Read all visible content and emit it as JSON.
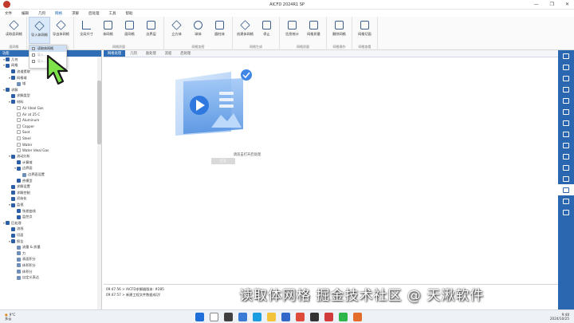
{
  "window": {
    "title": "AICFD 2024R1 SP",
    "controls": [
      "—",
      "❐",
      "✕"
    ]
  },
  "menu": [
    "文件",
    "编辑",
    "几何",
    "网格",
    "求解",
    "后处理",
    "工具",
    "帮助"
  ],
  "menu_active_index": 3,
  "ribbon": {
    "groups": [
      {
        "label": "面网格",
        "buttons": [
          {
            "label": "读取面网格",
            "icon": "mesh-read-icon"
          }
        ]
      },
      {
        "label": "",
        "buttons": [
          {
            "label": "导入体网格",
            "icon": "mesh-import-icon"
          },
          {
            "label": "导出体网格",
            "icon": "mesh-export-icon"
          }
        ]
      },
      {
        "label": "网格质量",
        "buttons": [
          {
            "label": "全局尺寸",
            "icon": "size-chart-icon"
          },
          {
            "label": "体网格",
            "icon": "volume-mesh-icon"
          },
          {
            "label": "面网格",
            "icon": "surface-mesh-icon"
          },
          {
            "label": "边界层",
            "icon": "boundary-layer-icon"
          }
        ]
      },
      {
        "label": "网格加密",
        "buttons": [
          {
            "label": "立方体",
            "icon": "cube-icon"
          },
          {
            "label": "球体",
            "icon": "sphere-icon"
          },
          {
            "label": "圆柱体",
            "icon": "cylinder-icon"
          }
        ]
      },
      {
        "label": "网格生成",
        "buttons": [
          {
            "label": "创建体网格",
            "icon": "create-mesh-icon"
          },
          {
            "label": "停止",
            "icon": "stop-icon"
          }
        ]
      },
      {
        "label": "网格质量",
        "buttons": [
          {
            "label": "信息统计",
            "icon": "statistics-icon"
          },
          {
            "label": "网格质量",
            "icon": "quality-icon"
          }
        ]
      },
      {
        "label": "网格操作",
        "buttons": [
          {
            "label": "删除网格",
            "icon": "delete-mesh-icon"
          }
        ]
      },
      {
        "label": "网格查看",
        "buttons": [
          {
            "label": "网格切面",
            "icon": "slice-icon"
          }
        ]
      }
    ]
  },
  "dropdown": {
    "items": [
      "读取体网格",
      "导入...",
      "导入..."
    ]
  },
  "left_panel": {
    "title": "功能",
    "tree": [
      {
        "label": "几何",
        "level": 0,
        "toggle": "▾",
        "icon": "node"
      },
      {
        "label": "网格",
        "level": 0,
        "toggle": "▾",
        "icon": "node"
      },
      {
        "label": "流道提取",
        "level": 1,
        "toggle": "",
        "icon": "node"
      },
      {
        "label": "网格域",
        "level": 1,
        "toggle": "▾",
        "icon": "node"
      },
      {
        "label": "域",
        "level": 2,
        "toggle": "",
        "icon": "leaf"
      },
      {
        "label": "求解",
        "level": 0,
        "toggle": "▾",
        "icon": "node"
      },
      {
        "label": "求解类型",
        "level": 1,
        "toggle": "",
        "icon": "node"
      },
      {
        "label": "材料",
        "level": 1,
        "toggle": "▾",
        "icon": "node"
      },
      {
        "label": "Air Ideal Gas",
        "level": 2,
        "toggle": "",
        "icon": "mat"
      },
      {
        "label": "Air at 25 C",
        "level": 2,
        "toggle": "",
        "icon": "mat"
      },
      {
        "label": "Aluminum",
        "level": 2,
        "toggle": "",
        "icon": "mat"
      },
      {
        "label": "Copper",
        "level": 2,
        "toggle": "",
        "icon": "mat"
      },
      {
        "label": "Soot",
        "level": 2,
        "toggle": "",
        "icon": "mat"
      },
      {
        "label": "Steel",
        "level": 2,
        "toggle": "",
        "icon": "mat"
      },
      {
        "label": "Water",
        "level": 2,
        "toggle": "",
        "icon": "mat"
      },
      {
        "label": "Water Ideal Gas",
        "level": 2,
        "toggle": "",
        "icon": "mat"
      },
      {
        "label": "流动分析",
        "level": 1,
        "toggle": "▾",
        "icon": "node"
      },
      {
        "label": "计算域",
        "level": 2,
        "toggle": "",
        "icon": "node"
      },
      {
        "label": "边界面",
        "level": 2,
        "toggle": "▾",
        "icon": "node"
      },
      {
        "label": "边界面设置",
        "level": 3,
        "toggle": "",
        "icon": "leaf"
      },
      {
        "label": "热模型",
        "level": 2,
        "toggle": "",
        "icon": "node"
      },
      {
        "label": "求解设置",
        "level": 1,
        "toggle": "",
        "icon": "node"
      },
      {
        "label": "求解控制",
        "level": 1,
        "toggle": "",
        "icon": "node"
      },
      {
        "label": "初始化",
        "level": 1,
        "toggle": "",
        "icon": "node"
      },
      {
        "label": "监视",
        "level": 1,
        "toggle": "▾",
        "icon": "node"
      },
      {
        "label": "残差曲线",
        "level": 2,
        "toggle": "",
        "icon": "node"
      },
      {
        "label": "监控点",
        "level": 2,
        "toggle": "",
        "icon": "node"
      },
      {
        "label": "后处理",
        "level": 0,
        "toggle": "▾",
        "icon": "node"
      },
      {
        "label": "流线",
        "level": 1,
        "toggle": "",
        "icon": "node"
      },
      {
        "label": "切面",
        "level": 1,
        "toggle": "",
        "icon": "node"
      },
      {
        "label": "报告",
        "level": 1,
        "toggle": "▾",
        "icon": "node"
      },
      {
        "label": "流量 & 质量",
        "level": 2,
        "toggle": "",
        "icon": "leaf"
      },
      {
        "label": "力",
        "level": 2,
        "toggle": "",
        "icon": "leaf"
      },
      {
        "label": "表面积分",
        "level": 2,
        "toggle": "",
        "icon": "leaf"
      },
      {
        "label": "体积积分",
        "level": 2,
        "toggle": "",
        "icon": "leaf"
      },
      {
        "label": "体积分",
        "level": 2,
        "toggle": "",
        "icon": "leaf"
      },
      {
        "label": "自定义表达",
        "level": 2,
        "toggle": "",
        "icon": "leaf"
      }
    ]
  },
  "tabs": [
    "网格处理",
    "几何",
    "面处理",
    "流程",
    "后处理"
  ],
  "active_tab_index": 0,
  "canvas": {
    "hint": "请双击打开后处理",
    "button": "打开"
  },
  "console": {
    "lines": [
      "09:47:56 > AICFD求解器版本: #285",
      "09:47:57 > 新建工程文件数据成功!"
    ]
  },
  "right_toolbar_selected": 12,
  "taskbar": {
    "weather_temp": "9°C",
    "weather_desc": "多云",
    "time": "9:48",
    "date": "2024/10/25",
    "apps": [
      {
        "name": "windows-start-icon",
        "color": "#1e6fd9"
      },
      {
        "name": "search-icon",
        "color": "#ffffff"
      },
      {
        "name": "task-view-icon",
        "color": "#404040"
      },
      {
        "name": "widgets-icon",
        "color": "#3a7bd5"
      },
      {
        "name": "edge-icon",
        "color": "#1b9de2"
      },
      {
        "name": "file-explorer-icon",
        "color": "#f3c33b"
      },
      {
        "name": "store-icon",
        "color": "#3268c7"
      },
      {
        "name": "chrome-icon",
        "color": "#de4b3a"
      },
      {
        "name": "terminal-icon",
        "color": "#333333"
      },
      {
        "name": "aicfd-icon",
        "color": "#d23b3b"
      },
      {
        "name": "wechat-icon",
        "color": "#2fb64a"
      },
      {
        "name": "video-app-icon",
        "color": "#e36b2c"
      }
    ]
  },
  "watermark": "读取体网格  掘金技术社区 @ 天湫软件",
  "colors": {
    "accent": "#2f6db6",
    "toolbar": "#2b66b1",
    "selection": "#dbe8f7"
  }
}
